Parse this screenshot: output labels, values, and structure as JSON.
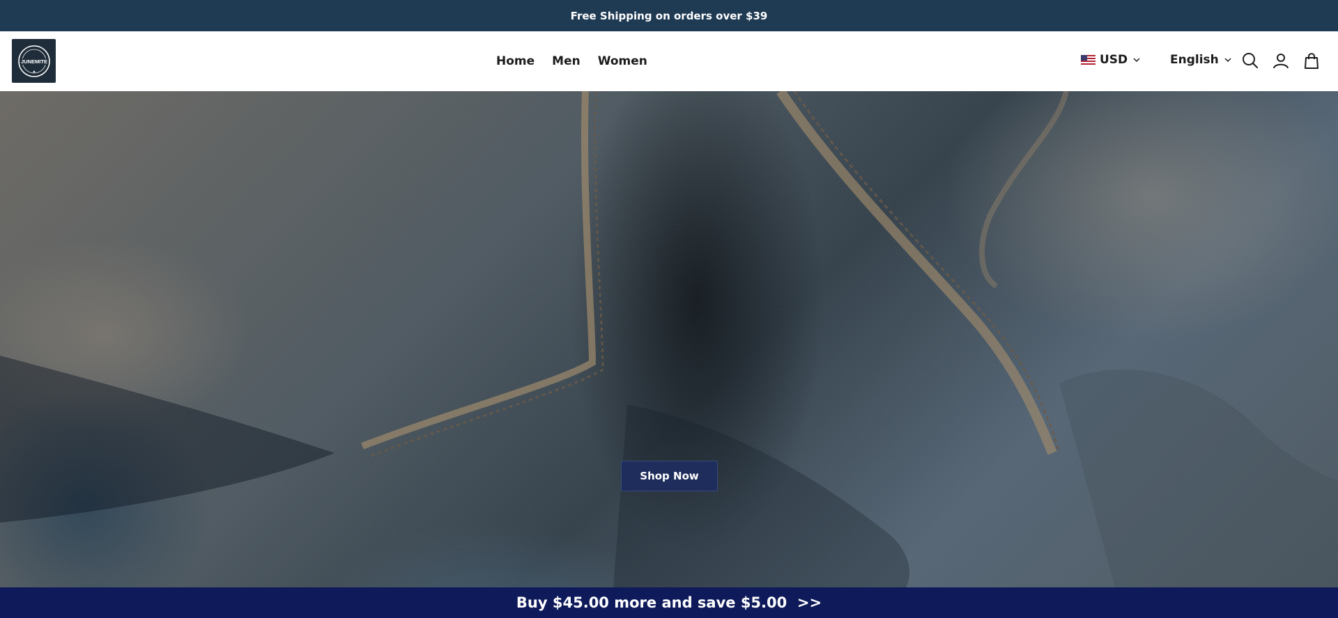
{
  "announcement": {
    "text": "Free Shipping on orders over $39"
  },
  "header": {
    "logo_text": "JUNEMITE",
    "nav": [
      {
        "label": "Home"
      },
      {
        "label": "Men"
      },
      {
        "label": "Women"
      }
    ],
    "currency": {
      "label": "USD",
      "flag": "us-flag-icon"
    },
    "language": {
      "label": "English"
    },
    "icons": [
      "search-icon",
      "account-icon",
      "cart-icon"
    ]
  },
  "hero": {
    "button_label": "Shop Now"
  },
  "promo_bar": {
    "text": "Buy $45.00 more and save $5.00  >>"
  },
  "colors": {
    "announcement_bg": "#1f3a53",
    "promo_bg": "#0f1a5a",
    "button_bg": "#1f2d5c"
  }
}
